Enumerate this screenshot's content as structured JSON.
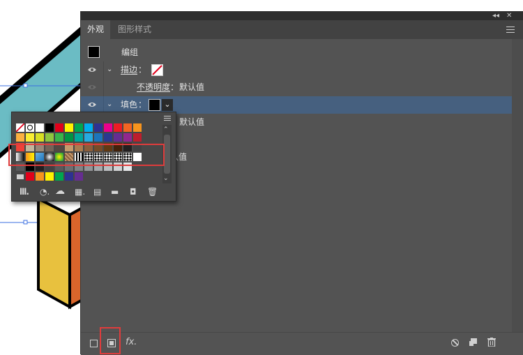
{
  "panel": {
    "collapse_icon": "double-chevron-left-icon",
    "close_icon": "close-icon",
    "tabs": [
      {
        "label": "外观",
        "active": true
      },
      {
        "label": "图形样式",
        "active": false
      }
    ],
    "menu_icon": "hamburger-icon"
  },
  "appearance": {
    "group_label": "编组",
    "stroke_label": "描边",
    "opacity_label": "不透明度",
    "opacity_value": "默认值",
    "fill_label": "填色",
    "fill_opacity_value": "默认值",
    "row6_value": "认值",
    "colon": "："
  },
  "bottom_toolbar": {
    "icons": [
      "new-stroke-icon",
      "new-fill-icon",
      "fx-icon",
      "clear-appearance-icon",
      "duplicate-item-icon",
      "delete-item-icon"
    ],
    "fx_label": "fx."
  },
  "swatches_popup": {
    "bottom_icons": [
      "swatch-library-icon",
      "show-kinds-icon",
      "swatch-options-icon",
      "color-group-icon",
      "new-swatch-icon",
      "new-folder-icon",
      "delete-swatch-icon"
    ],
    "list_view_icon": "list-view-icon"
  },
  "colors": {
    "panel_bg": "#535353",
    "selected_row": "#46607f",
    "highlight_box": "#e03c3c",
    "artwork_teal": "#6bbcc4",
    "artwork_yellow": "#e8c13e",
    "artwork_orange": "#d9652b"
  }
}
